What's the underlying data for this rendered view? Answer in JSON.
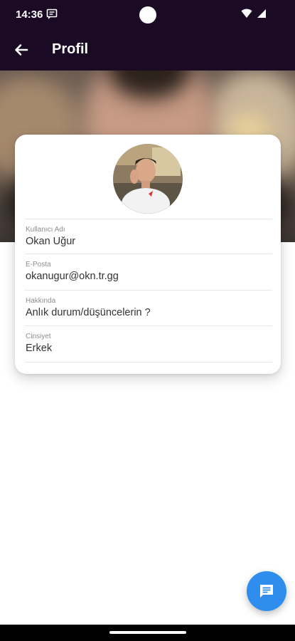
{
  "status_bar": {
    "time": "14:36"
  },
  "app_bar": {
    "title": "Profil"
  },
  "profile": {
    "fields": [
      {
        "label": "Kullanıcı Adı",
        "value": "Okan Uğur"
      },
      {
        "label": "E-Posta",
        "value": "okanugur@okn.tr.gg"
      },
      {
        "label": "Hakkında",
        "value": "Anlık durum/düşüncelerin ?"
      },
      {
        "label": "Cinsiyet",
        "value": "Erkek"
      }
    ]
  },
  "colors": {
    "app_bar_bg": "#1a0a24",
    "fab_bg": "#2f8eed"
  },
  "icons": {
    "back": "arrow-left-icon",
    "status_message": "message-icon",
    "wifi": "wifi-icon",
    "signal": "signal-icon",
    "fab": "chat-icon"
  }
}
